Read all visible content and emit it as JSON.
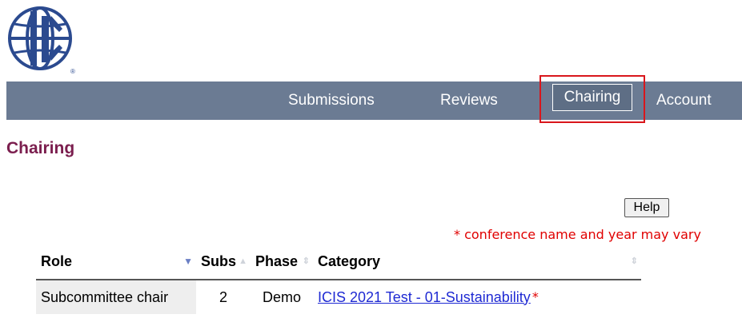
{
  "header": {
    "logo_icon": "globe-icon",
    "logo_mark": "®"
  },
  "nav": {
    "items": [
      {
        "label": "Submissions"
      },
      {
        "label": "Reviews"
      },
      {
        "label": "Chairing",
        "active": true
      },
      {
        "label": "Account"
      }
    ],
    "bar_color": "#6b7b93",
    "highlight_color": "#d9161c"
  },
  "main": {
    "title": "Chairing",
    "help_label": "Help",
    "note": "* conference name and year may vary",
    "table": {
      "columns": [
        {
          "label": "Role",
          "sort": "descending"
        },
        {
          "label": "Subs"
        },
        {
          "label": "Phase"
        },
        {
          "label": "Category"
        }
      ],
      "rows": [
        {
          "role": "Subcommittee chair",
          "subs": "2",
          "phase": "Demo",
          "category": "ICIS 2021 Test - 01-Sustainability",
          "category_mark": "*"
        }
      ]
    },
    "title_color": "#7b1e4e",
    "link_color": "#1f2ad3"
  }
}
